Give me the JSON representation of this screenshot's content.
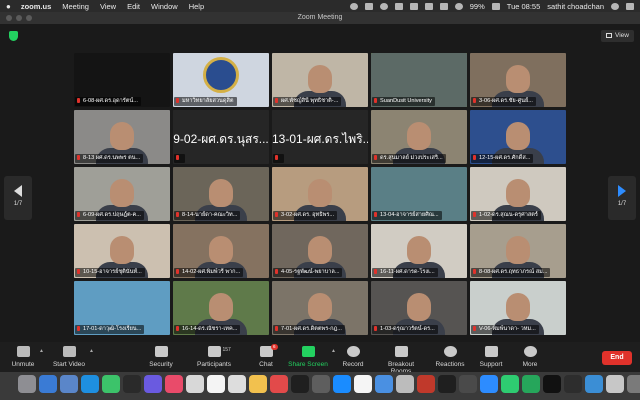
{
  "menubar": {
    "app": "zoom.us",
    "items": [
      "Meeting",
      "View",
      "Edit",
      "Window",
      "Help"
    ],
    "battery": "99%",
    "clock": "Tue 08:55",
    "user": "sathit choadchan"
  },
  "window": {
    "title": "Zoom Meeting"
  },
  "view_button": {
    "label": "View"
  },
  "pager": {
    "left": "1/7",
    "right": "1/7"
  },
  "tiles": [
    {
      "label": "6-08-ผศ.ดร.อุดารัตน์...",
      "big": "",
      "scene": "#141414",
      "person": false
    },
    {
      "label": "มหาวิทยาลัยสวนดุสิต",
      "big": "",
      "scene": "#cfd6e0",
      "person": false,
      "logo": true
    },
    {
      "label": "ผศ.พัชญ์สินี พุทธิชาติ-...",
      "big": "",
      "scene": "#bfb6a6",
      "person": true
    },
    {
      "label": "SuanDusit University",
      "big": "",
      "scene": "#5c6a66",
      "person": false,
      "speaking": true
    },
    {
      "label": "3-06-ผศ.ดร.ชัย-ศูนย์...",
      "big": "",
      "scene": "#7f6f5e",
      "person": true
    },
    {
      "label": "8-13 ผศ.ดร.นพพร ตน...",
      "big": "",
      "scene": "#8b8a88",
      "person": true
    },
    {
      "label": "",
      "big": "9-02-ผศ.ดร.นุสร...",
      "scene": "#262626",
      "person": false
    },
    {
      "label": "",
      "big": "13-01-ผศ.ดร.ไพริ...",
      "scene": "#262626",
      "person": false
    },
    {
      "label": "ดร.สุนมาลย์ ม่วงประเสริ...",
      "big": "",
      "scene": "#8c8472",
      "person": true
    },
    {
      "label": "12-15-ผศ.ดร.ศักดิ์ส...",
      "big": "",
      "scene": "#2d4f8e",
      "person": true
    },
    {
      "label": "6-09-ผศ.ดร.ปฤษฎ์ต-ค...",
      "big": "",
      "scene": "#9f9f98",
      "person": true
    },
    {
      "label": "8-14-นาย์ดา-คณะวิท...",
      "big": "",
      "scene": "#6b6559",
      "person": true
    },
    {
      "label": "3-02-ผศ.ดร. อุทธิพร...",
      "big": "",
      "scene": "#b79c7f",
      "person": true
    },
    {
      "label": "13-04-อาจารย์สายศิณ...",
      "big": "",
      "scene": "#5a7f86",
      "person": false
    },
    {
      "label": "1-02-ดร.สุณน-ดรุศาสตร์",
      "big": "",
      "scene": "#cfc9bf",
      "person": true
    },
    {
      "label": "10-15-อาจารย์ชุตินันท์...",
      "big": "",
      "scene": "#ccc0b0",
      "person": true
    },
    {
      "label": "14-02-ผศ.พิมพ์วรี พาก...",
      "big": "",
      "scene": "#857260",
      "person": true
    },
    {
      "label": "4-05-รฐพัฒน์-พยาบาล...",
      "big": "",
      "scene": "#70675d",
      "person": true
    },
    {
      "label": "16-11-ผศ.ดารด-โรงเ...",
      "big": "",
      "scene": "#d1ccc3",
      "person": true
    },
    {
      "label": "8-08-ผศ.ดร.ฤทธาภรณ์ สม...",
      "big": "",
      "scene": "#a79e8e",
      "person": true
    },
    {
      "label": "17-01-ดาวุฒิ-โรงเรียน...",
      "big": "",
      "scene": "#5f9dc2",
      "person": false
    },
    {
      "label": "16-14-ดร.ณัชรา-เทค...",
      "big": "",
      "scene": "#5f7a4a",
      "person": true
    },
    {
      "label": "7-01-ผศ.ดร.ดิตตพร-กฎ...",
      "big": "",
      "scene": "#7c7468",
      "person": true
    },
    {
      "label": "1-03-ดรุณาวรัตน์-ดร...",
      "big": "",
      "scene": "#565452",
      "person": true
    },
    {
      "label": "V-06-พิมพ์นาดา- วหม...",
      "big": "",
      "scene": "#c9cfcc",
      "person": true
    }
  ],
  "toolbar": {
    "unmute": "Unmute",
    "start_video": "Start Video",
    "security": "Security",
    "participants": "Participants",
    "participants_count": "157",
    "chat": "Chat",
    "chat_badge": "6",
    "share_screen": "Share Screen",
    "record": "Record",
    "breakout_rooms": "Breakout Rooms",
    "reactions": "Reactions",
    "support": "Support",
    "more": "More",
    "end": "End"
  },
  "dock_colors": [
    "#8e8e93",
    "#3a7bd5",
    "#5a86c9",
    "#1e8fe0",
    "#3cc36a",
    "#2a2a2a",
    "#6a5ae0",
    "#e94b6a",
    "#d8d8d8",
    "#f4f4f4",
    "#dddddd",
    "#f2c14e",
    "#e24a4a",
    "#1f1f1f",
    "#5e5e5e",
    "#1a8cff",
    "#f5f5f5",
    "#4a90e2",
    "#bcbcbc",
    "#c0392b",
    "#1f1f1f",
    "#4a4a4a",
    "#2d8cff",
    "#2ecc71",
    "#26a65b",
    "#111111",
    "#2d2d2d",
    "#3b8ed5",
    "#c7c7c7",
    "#7a7a7a"
  ]
}
